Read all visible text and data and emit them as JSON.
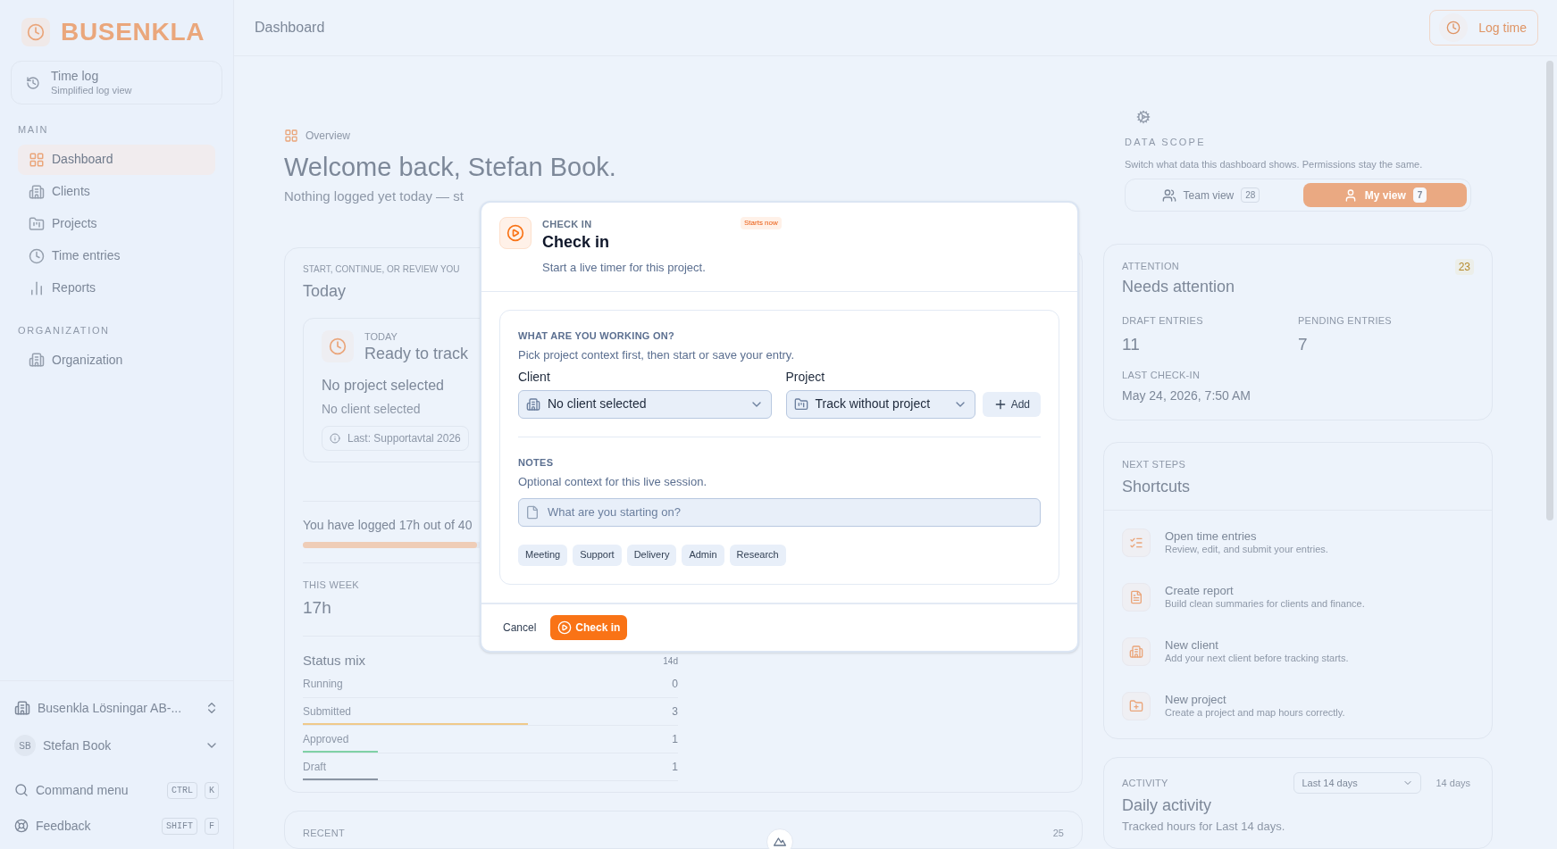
{
  "header": {
    "title": "Dashboard",
    "log_time": "Log time"
  },
  "sidebar": {
    "brand": "BUSENKLA",
    "time_log": {
      "title": "Time log",
      "subtitle": "Simplified log view"
    },
    "sections": [
      {
        "heading": "MAIN",
        "items": [
          {
            "label": "Dashboard",
            "selected": true
          },
          {
            "label": "Clients",
            "selected": false
          },
          {
            "label": "Projects",
            "selected": false
          },
          {
            "label": "Time entries",
            "selected": false
          },
          {
            "label": "Reports",
            "selected": false
          }
        ]
      },
      {
        "heading": "ORGANIZATION",
        "items": [
          {
            "label": "Organization",
            "selected": false
          }
        ]
      }
    ],
    "org": "Busenkla Lösningar AB-...",
    "user": {
      "initials": "SB",
      "name": "Stefan Book"
    },
    "commands": [
      {
        "label": "Command menu",
        "keys": [
          "CTRL",
          "K"
        ]
      },
      {
        "label": "Feedback",
        "keys": [
          "SHIFT",
          "F"
        ]
      }
    ]
  },
  "overview": {
    "breadcrumb": "Overview",
    "title": "Welcome back, Stefan Book.",
    "subtitle": "Nothing logged yet today — st"
  },
  "today_card": {
    "eyebrow": "START, CONTINUE, OR REVIEW YOU",
    "title": "Today",
    "tracker": {
      "eyebrow": "TODAY",
      "title": "Ready to track",
      "project": "No project selected",
      "client": "No client selected",
      "last": "Last: Supportavtal 2026"
    },
    "progress": {
      "text": "You have logged 17h out of 40",
      "level": 0.43
    },
    "week": {
      "label": "THIS WEEK",
      "value": "17h"
    },
    "status_mix": {
      "title": "Status mix",
      "range": "14d",
      "rows": [
        {
          "label": "Running",
          "count": "0"
        },
        {
          "label": "Submitted",
          "count": "3",
          "level": 0.6,
          "color": "#efc98a"
        },
        {
          "label": "Approved",
          "count": "1",
          "level": 0.2,
          "color": "#7fd1a6"
        },
        {
          "label": "Draft",
          "count": "1",
          "level": 0.2,
          "color": "#8a94a3"
        }
      ]
    }
  },
  "recent": {
    "eyebrow": "RECENT",
    "count": "25"
  },
  "data_scope": {
    "eyebrow": "DATA SCOPE",
    "description": "Switch what data this dashboard shows. Permissions stay the same.",
    "options": [
      {
        "label": "Team view",
        "count": "28",
        "selected": false
      },
      {
        "label": "My view",
        "count": "7",
        "selected": true
      }
    ]
  },
  "attention": {
    "eyebrow": "ATTENTION",
    "title": "Needs attention",
    "badge": "23",
    "stats": [
      {
        "label": "DRAFT ENTRIES",
        "value": "11"
      },
      {
        "label": "PENDING ENTRIES",
        "value": "7"
      }
    ],
    "last_label": "LAST CHECK-IN",
    "last_value": "May 24, 2026, 7:50 AM"
  },
  "shortcuts": {
    "eyebrow": "NEXT STEPS",
    "title": "Shortcuts",
    "items": [
      {
        "title": "Open time entries",
        "description": "Review, edit, and submit your entries."
      },
      {
        "title": "Create report",
        "description": "Build clean summaries for clients and finance."
      },
      {
        "title": "New client",
        "description": "Add your next client before tracking starts."
      },
      {
        "title": "New project",
        "description": "Create a project and map hours correctly."
      }
    ]
  },
  "activity": {
    "eyebrow": "ACTIVITY",
    "title": "Daily activity",
    "subtitle": "Tracked hours for Last 14 days.",
    "range_select": "Last 14 days",
    "range_badge": "14 days"
  },
  "dialog": {
    "eyebrow": "CHECK IN",
    "title": "Check in",
    "badge": "Starts now",
    "subtitle": "Start a live timer for this project.",
    "section": {
      "eyebrow": "WHAT ARE YOU WORKING ON?",
      "description": "Pick project context first, then start or save your entry.",
      "client": {
        "label": "Client",
        "value": "No client selected"
      },
      "project": {
        "label": "Project",
        "value": "Track without project"
      },
      "add": "Add"
    },
    "notes": {
      "eyebrow": "NOTES",
      "description": "Optional context for this live session.",
      "placeholder": "What are you starting on?"
    },
    "tags": [
      "Meeting",
      "Support",
      "Delivery",
      "Admin",
      "Research"
    ],
    "cancel": "Cancel",
    "submit": "Check in"
  }
}
